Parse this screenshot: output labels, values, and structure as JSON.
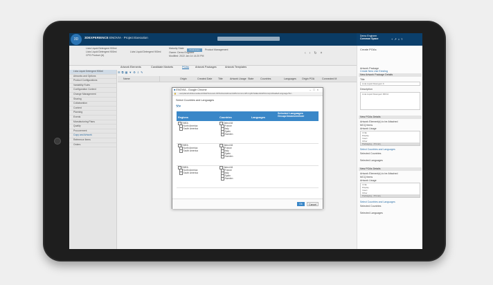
{
  "app": {
    "brand_bold": "3DEXPERIENCE",
    "brand_rest": " ENOVIA · Project Execution",
    "user_line1": "Demo Engineer",
    "user_line2": "Common Space",
    "logo": "3D"
  },
  "header": {
    "obj_title": "Livia Liquid Detergent 900ml",
    "obj_sub": "Livia Liquid Detergent 900ml",
    "obj_meta": "CPG Product (A)",
    "center_title": "Livia Liquid Detergent 900ml",
    "maturity_label": "Maturity State",
    "maturity_value": "Preliminary",
    "owner_line": "Owner: Demo Engineer",
    "modified_line": "Modified: 2022 Jan 14 14:20 PM",
    "product_link": "Product Management"
  },
  "tabs": [
    "Artwork Elements",
    "Candidate Markets",
    "POAs",
    "Artwork Packages",
    "Artwork Templates"
  ],
  "grid_headers": [
    "Name",
    "Origin",
    "Created Date",
    "Title",
    "Artwork Usage",
    "State",
    "Countries",
    "Languages",
    "Origin POA",
    "Connected M"
  ],
  "sidebar": [
    "Livia Liquid Detergent 900ml",
    "Artworks and Options",
    "Product Configurations",
    "Variability Rules",
    "Configuration Context",
    "Change Management",
    "Sharing",
    "Collaboration",
    "Content",
    "Planning",
    "Events",
    "Manufacturing Plans",
    "Quality",
    "Procurement",
    "Copy and Artwork",
    "Reference Items",
    "Orders"
  ],
  "dialog": {
    "title": "ENOVIA - Google Chrome",
    "url": "...aunplace/toFdeLoadseuGNtelTosLoam-ID/Subsc/eldmentAWLCommonPL/oyRch/aEenbAWLGrorpsDwalle/Language/Tel...",
    "select_label": "Select Countries and Languages",
    "columns": [
      "Regions",
      "Countries",
      "Languages",
      "Selected Languages Group/Jeaneoreetore"
    ],
    "rows": [
      {
        "regions": [
          "EMEA",
          "North America",
          "South America"
        ],
        "countries": [
          "Select All",
          "France",
          "Italy",
          "Spain",
          "Sweden"
        ]
      },
      {
        "regions": [
          "EMEA",
          "North America",
          "South America"
        ],
        "countries": [
          "Select All",
          "France",
          "Italy",
          "Spain",
          "Sweden"
        ]
      },
      {
        "regions": [
          "EMEA",
          "North America",
          "South America"
        ],
        "countries": [
          "Select All",
          "France",
          "Italy",
          "Spain",
          "Sweden"
        ]
      }
    ],
    "ok_label": "Ok",
    "cancel_label": "Cancel"
  },
  "right_panel": {
    "title": "Create POAs",
    "artwork_package_label": "Artwork Package",
    "radio_label": "Create New  Use Existing",
    "section_new_package": "New Artwork Package Details",
    "title_label": "Title",
    "title_value": "Livia Liquid Detergent 9",
    "desc_label": "Description",
    "desc_value": "Livia Liquid Detergent 900ml",
    "section_new_poas": "New POAs Details",
    "attach_label": "Artwork Element(s) to be Attached",
    "attach_value": "MCQ Items",
    "usage_label": "Artwork Usage",
    "usage_list": [
      "3 NE",
      "Display",
      "Insert",
      "Other",
      "Packaging - Primary"
    ],
    "link_select": "Select Countries and Languages",
    "selected_countries": "Selected Countries",
    "selected_languages": "Selected Languages",
    "section_new_poas2": "New POAs Details",
    "attach_label2": "Artwork Element(s) to be Attached",
    "attach_value2": "MCQ Items",
    "usage_label2": "Artwork Usage",
    "usage_list2": [
      "3 NE",
      "Display",
      "Insert",
      "Other",
      "Packaging - Primary"
    ],
    "link_select2": "Select Countries and Languages",
    "selected_countries2": "Selected Countries",
    "selected_languages2": "Selected Languages"
  }
}
